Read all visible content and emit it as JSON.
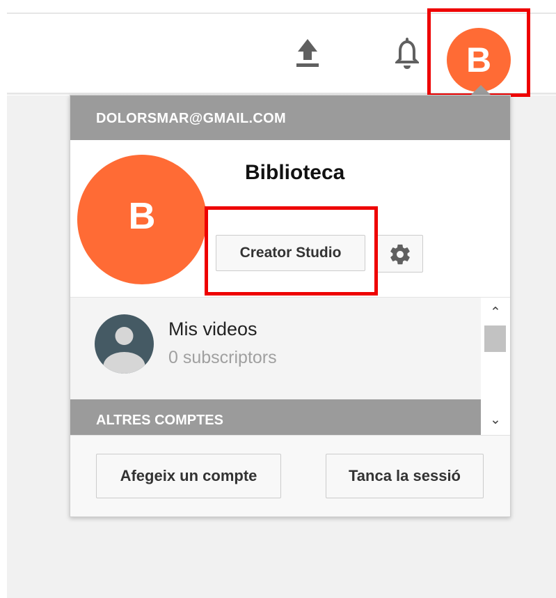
{
  "header": {
    "upload_icon": "upload-icon",
    "notifications_icon": "bell-icon",
    "avatar_letter": "B",
    "avatar_color": "#ff6b35"
  },
  "account_menu": {
    "email": "DOLORSMAR@GMAIL.COM",
    "avatar_letter": "B",
    "channel_name": "Biblioteca",
    "creator_studio_label": "Creator Studio",
    "settings_icon": "gear-icon",
    "accounts": [
      {
        "name": "Mis videos",
        "subscribers": "0 subscriptors"
      }
    ],
    "other_accounts_title": "ALTRES COMPTES",
    "add_account_label": "Afegeix un compte",
    "sign_out_label": "Tanca la sessió"
  },
  "highlight_color": "#ee0000"
}
